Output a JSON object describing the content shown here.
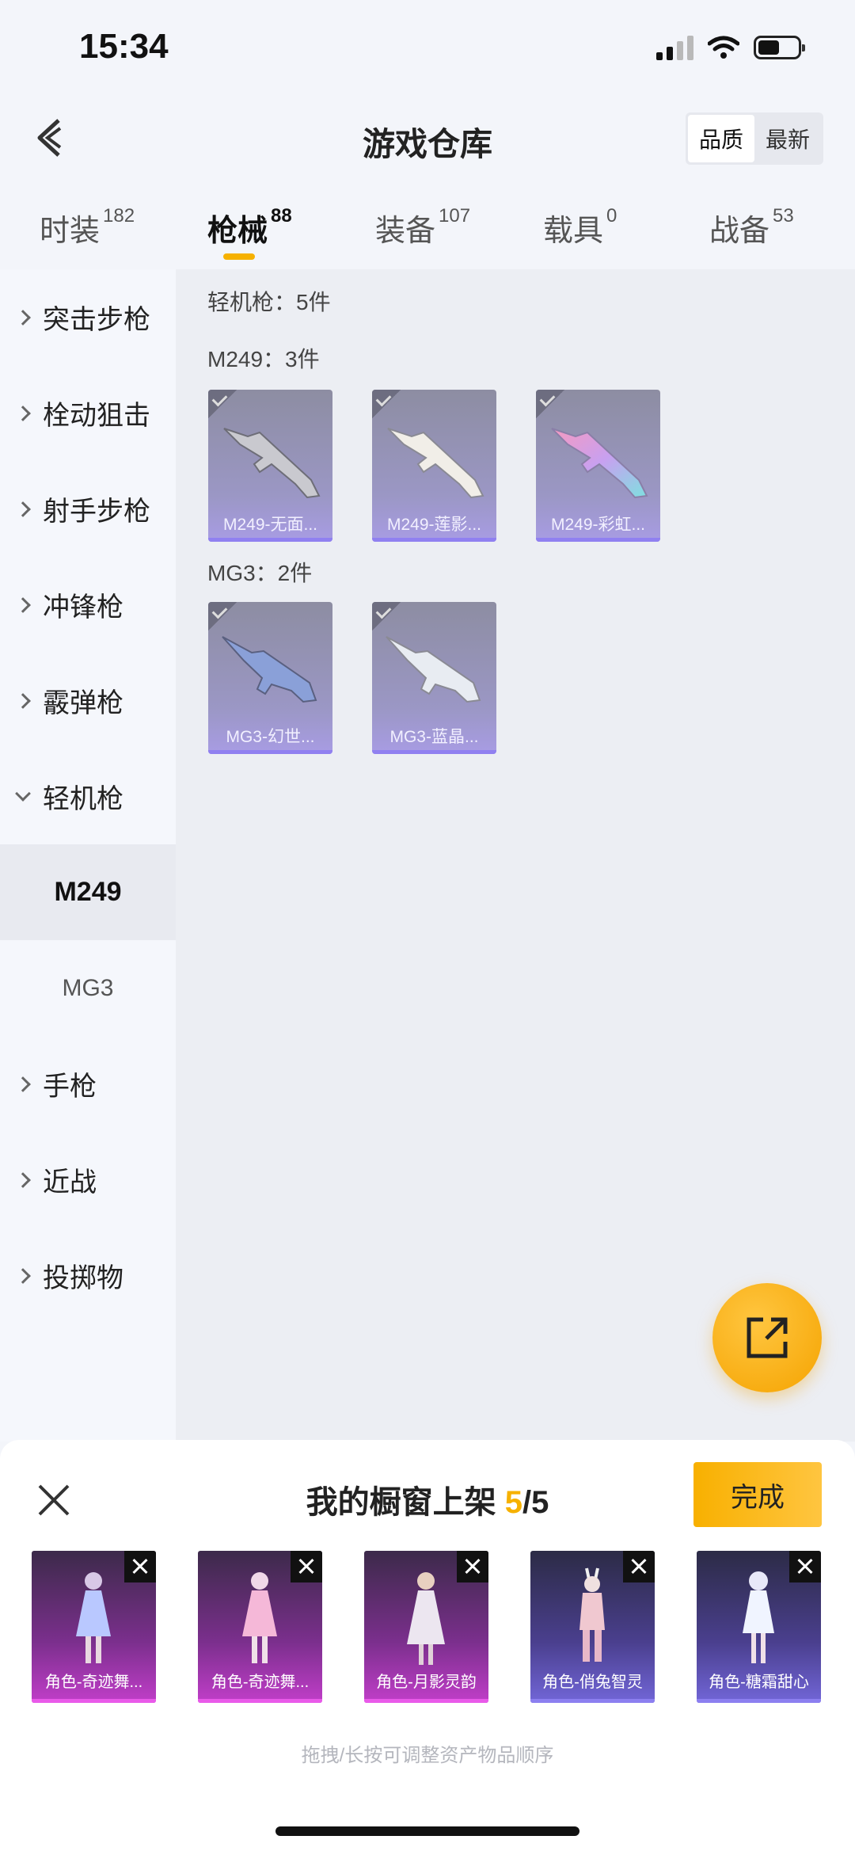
{
  "status_bar": {
    "time": "15:34"
  },
  "header": {
    "title": "游戏仓库",
    "sort_options": [
      "品质",
      "最新"
    ],
    "active_sort": "品质"
  },
  "tabs": [
    {
      "label": "时装",
      "count": "182"
    },
    {
      "label": "枪械",
      "count": "88"
    },
    {
      "label": "装备",
      "count": "107"
    },
    {
      "label": "载具",
      "count": "0"
    },
    {
      "label": "战备",
      "count": "53"
    }
  ],
  "active_tab": "枪械",
  "sidebar": {
    "items": [
      {
        "label": "突击步枪"
      },
      {
        "label": "栓动狙击"
      },
      {
        "label": "射手步枪"
      },
      {
        "label": "冲锋枪"
      },
      {
        "label": "霰弹枪"
      },
      {
        "label": "轻机枪"
      },
      {
        "label": "M249"
      },
      {
        "label": "MG3"
      },
      {
        "label": "手枪"
      },
      {
        "label": "近战"
      },
      {
        "label": "投掷物"
      }
    ]
  },
  "content": {
    "category_title": "轻机枪：5件",
    "groups": [
      {
        "title": "M249：3件",
        "items": [
          "M249-无面...",
          "M249-莲影...",
          "M249-彩虹..."
        ]
      },
      {
        "title": "MG3：2件",
        "items": [
          "MG3-幻世...",
          "MG3-蓝晶..."
        ]
      }
    ]
  },
  "sheet": {
    "title_prefix": "我的橱窗上架 ",
    "current": "5",
    "total": "/5",
    "done_label": "完成",
    "items": [
      "角色-奇迹舞...",
      "角色-奇迹舞...",
      "角色-月影灵韵",
      "角色-俏兔智灵",
      "角色-糖霜甜心"
    ],
    "hint": "拖拽/长按可调整资产物品顺序"
  },
  "colors": {
    "accent": "#f6b100",
    "card_purple": "#9b97c5",
    "showcase_pink": "#c13ec9",
    "showcase_blue": "#7266d8"
  }
}
